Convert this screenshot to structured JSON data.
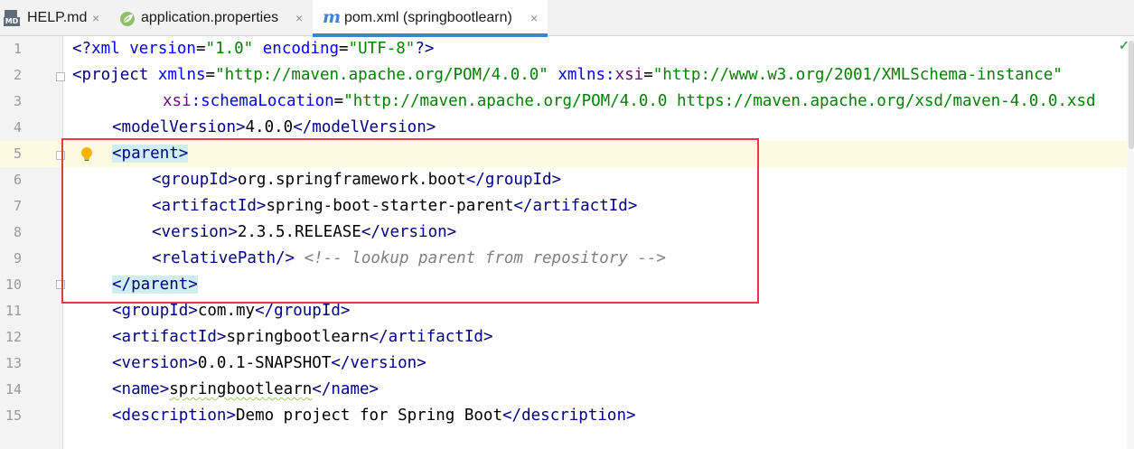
{
  "tabs": [
    {
      "label": "HELP.md",
      "icon": "markdown-file-icon",
      "close": "×"
    },
    {
      "label": "application.properties",
      "icon": "spring-leaf-icon",
      "close": "×"
    },
    {
      "label": "pom.xml (springbootlearn)",
      "icon": "maven-m-icon",
      "icon_text": "m",
      "close": "×",
      "active": true
    }
  ],
  "status_check": "✓",
  "line_numbers": [
    "1",
    "2",
    "3",
    "4",
    "5",
    "6",
    "7",
    "8",
    "9",
    "10",
    "11",
    "12",
    "13",
    "14",
    "15"
  ],
  "code": {
    "l1": {
      "a": "<?",
      "b": "xml version",
      "c": "=",
      "d": "\"1.0\"",
      "e": " encoding",
      "f": "=",
      "g": "\"UTF-8\"",
      "h": "?>"
    },
    "l2": {
      "a": "<",
      "b": "project",
      "c": " xmlns",
      "d": "=",
      "e": "\"http://maven.apache.org/POM/4.0.0\"",
      "f": " xmlns:",
      "g": "xsi",
      "h": "=",
      "i": "\"http://www.w3.org/2001/XMLSchema-instance\""
    },
    "l3": {
      "a": "xsi",
      "b": ":schemaLocation",
      "c": "=",
      "d": "\"http://maven.apache.org/POM/4.0.0 https://maven.apache.org/xsd/maven-4.0.0.xsd"
    },
    "l4": {
      "open": "modelVersion",
      "text": "4.0.0",
      "close": "modelVersion"
    },
    "l5": {
      "open": "parent"
    },
    "l6": {
      "open": "groupId",
      "text": "org.springframework.boot",
      "close": "groupId"
    },
    "l7": {
      "open": "artifactId",
      "text": "spring-boot-starter-parent",
      "close": "artifactId"
    },
    "l8": {
      "open": "version",
      "text": "2.3.5.RELEASE",
      "close": "version"
    },
    "l9": {
      "tag": "relativePath",
      "comment": "<!-- lookup parent from repository -->"
    },
    "l10": {
      "close": "parent"
    },
    "l11": {
      "open": "groupId",
      "text": "com.my",
      "close": "groupId"
    },
    "l12": {
      "open": "artifactId",
      "text": "springbootlearn",
      "close": "artifactId"
    },
    "l13": {
      "open": "version",
      "text": "0.0.1-SNAPSHOT",
      "close": "version"
    },
    "l14": {
      "open": "name",
      "text": "springbootlearn",
      "close": "name"
    },
    "l15": {
      "open": "description",
      "text": "Demo project for Spring Boot",
      "close": "description"
    }
  },
  "colors": {
    "tag": "#000080",
    "attribute": "#0000ff",
    "value": "#008000",
    "comment": "#808080",
    "highlight_box": "#e03d3d",
    "current_line": "#fcfae1"
  }
}
